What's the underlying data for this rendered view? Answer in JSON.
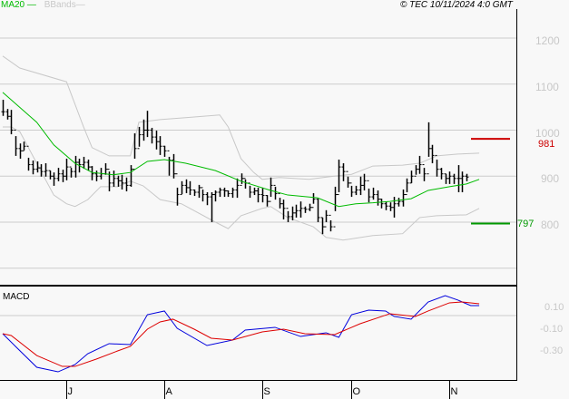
{
  "header": {
    "legend_ma": "MA20",
    "legend_bb": "BBands",
    "timestamp": "© TEC 10/11/2024 4:0 GMT"
  },
  "macd_label": "MACD",
  "chart_data": {
    "type": "ohlc",
    "price_axis": {
      "ticks": [
        1200,
        1100,
        1000,
        900,
        800,
        700
      ],
      "labels": [
        "1200",
        "1100",
        "1000",
        "900",
        "800"
      ],
      "ylim": [
        700,
        1200
      ]
    },
    "macd_axis": {
      "labels": [
        "0.10",
        "-0.10",
        "-0.30"
      ],
      "values": [
        0.1,
        -0.1,
        -0.3
      ],
      "grid": [
        0.1
      ]
    },
    "x_ticks": [
      {
        "label": "J",
        "bar": 15
      },
      {
        "label": "A",
        "bar": 38
      },
      {
        "label": "S",
        "bar": 61
      },
      {
        "label": "O",
        "bar": 82
      },
      {
        "label": "N",
        "bar": 105
      }
    ],
    "bars": [
      [
        1066,
        1031,
        1040
      ],
      [
        1046,
        1023,
        1030
      ],
      [
        1044,
        991,
        1000
      ],
      [
        987,
        944,
        960
      ],
      [
        971,
        938,
        955
      ],
      [
        975,
        956,
        965
      ],
      [
        940,
        912,
        925
      ],
      [
        934,
        904,
        915
      ],
      [
        932,
        908,
        918
      ],
      [
        926,
        899,
        910
      ],
      [
        928,
        899,
        912
      ],
      [
        912,
        893,
        900
      ],
      [
        908,
        879,
        895
      ],
      [
        918,
        889,
        905
      ],
      [
        914,
        887,
        900
      ],
      [
        938,
        891,
        920
      ],
      [
        918,
        897,
        910
      ],
      [
        944,
        897,
        930
      ],
      [
        938,
        908,
        925
      ],
      [
        942,
        916,
        930
      ],
      [
        936,
        912,
        920
      ],
      [
        922,
        891,
        905
      ],
      [
        912,
        889,
        900
      ],
      [
        918,
        893,
        905
      ],
      [
        928,
        903,
        915
      ],
      [
        910,
        867,
        885
      ],
      [
        912,
        877,
        895
      ],
      [
        901,
        877,
        890
      ],
      [
        903,
        871,
        885
      ],
      [
        897,
        867,
        880
      ],
      [
        924,
        877,
        915
      ],
      [
        993,
        938,
        960
      ],
      [
        1007,
        964,
        990
      ],
      [
        1023,
        977,
        1000
      ],
      [
        1042,
        985,
        1000
      ],
      [
        1005,
        971,
        985
      ],
      [
        999,
        958,
        975
      ],
      [
        987,
        946,
        965
      ],
      [
        966,
        942,
        955
      ],
      [
        942,
        901,
        935
      ],
      [
        948,
        895,
        905
      ],
      [
        875,
        836,
        860
      ],
      [
        889,
        861,
        880
      ],
      [
        893,
        863,
        875
      ],
      [
        889,
        859,
        870
      ],
      [
        871,
        857,
        865
      ],
      [
        881,
        853,
        875
      ],
      [
        871,
        845,
        860
      ],
      [
        865,
        837,
        855
      ],
      [
        865,
        800,
        860
      ],
      [
        869,
        845,
        865
      ],
      [
        875,
        855,
        870
      ],
      [
        875,
        855,
        868
      ],
      [
        869,
        855,
        862
      ],
      [
        875,
        853,
        870
      ],
      [
        895,
        853,
        880
      ],
      [
        906,
        883,
        895
      ],
      [
        893,
        873,
        885
      ],
      [
        879,
        853,
        865
      ],
      [
        875,
        859,
        868
      ],
      [
        875,
        843,
        860
      ],
      [
        875,
        843,
        858
      ],
      [
        859,
        834,
        845
      ],
      [
        897,
        855,
        880
      ],
      [
        877,
        849,
        862
      ],
      [
        853,
        830,
        840
      ],
      [
        849,
        806,
        830
      ],
      [
        824,
        800,
        812
      ],
      [
        834,
        804,
        820
      ],
      [
        838,
        810,
        825
      ],
      [
        845,
        810,
        830
      ],
      [
        834,
        820,
        828
      ],
      [
        840,
        824,
        832
      ],
      [
        863,
        840,
        850
      ],
      [
        851,
        800,
        810
      ],
      [
        810,
        774,
        790
      ],
      [
        826,
        800,
        815
      ],
      [
        804,
        780,
        790
      ],
      [
        877,
        824,
        860
      ],
      [
        936,
        865,
        920
      ],
      [
        928,
        889,
        910
      ],
      [
        899,
        875,
        885
      ],
      [
        879,
        855,
        865
      ],
      [
        879,
        859,
        870
      ],
      [
        899,
        859,
        880
      ],
      [
        905,
        869,
        890
      ],
      [
        873,
        843,
        855
      ],
      [
        875,
        849,
        860
      ],
      [
        869,
        836,
        850
      ],
      [
        851,
        830,
        840
      ],
      [
        845,
        826,
        835
      ],
      [
        843,
        824,
        832
      ],
      [
        855,
        810,
        840
      ],
      [
        853,
        834,
        845
      ],
      [
        871,
        834,
        860
      ],
      [
        895,
        865,
        885
      ],
      [
        912,
        885,
        900
      ],
      [
        924,
        903,
        915
      ],
      [
        944,
        905,
        925
      ],
      [
        918,
        889,
        905
      ],
      [
        1017,
        942,
        960
      ],
      [
        968,
        928,
        945
      ],
      [
        936,
        899,
        915
      ],
      [
        918,
        893,
        905
      ],
      [
        905,
        883,
        895
      ],
      [
        910,
        883,
        900
      ],
      [
        905,
        883,
        895
      ],
      [
        924,
        865,
        895
      ],
      [
        910,
        865,
        900
      ],
      [
        905,
        889,
        898
      ]
    ],
    "ma20": [
      [
        0,
        1082
      ],
      [
        8,
        1017
      ],
      [
        12,
        968
      ],
      [
        17,
        928
      ],
      [
        21,
        908
      ],
      [
        26,
        903
      ],
      [
        30,
        908
      ],
      [
        34,
        932
      ],
      [
        38,
        936
      ],
      [
        43,
        928
      ],
      [
        50,
        912
      ],
      [
        56,
        889
      ],
      [
        63,
        869
      ],
      [
        67,
        859
      ],
      [
        74,
        853
      ],
      [
        79,
        834
      ],
      [
        83,
        840
      ],
      [
        87,
        842
      ],
      [
        91,
        845
      ],
      [
        96,
        851
      ],
      [
        100,
        869
      ],
      [
        105,
        877
      ],
      [
        109,
        883
      ],
      [
        112,
        893
      ]
    ],
    "bb_upper": [
      [
        0,
        1161
      ],
      [
        4,
        1135
      ],
      [
        15,
        1105
      ],
      [
        19,
        1007
      ],
      [
        21,
        962
      ],
      [
        25,
        944
      ],
      [
        30,
        944
      ],
      [
        32,
        1017
      ],
      [
        37,
        1023
      ],
      [
        43,
        1027
      ],
      [
        51,
        1033
      ],
      [
        53,
        1007
      ],
      [
        56,
        938
      ],
      [
        59,
        908
      ],
      [
        61,
        893
      ],
      [
        65,
        897
      ],
      [
        72,
        893
      ],
      [
        77,
        899
      ],
      [
        82,
        904
      ],
      [
        87,
        922
      ],
      [
        94,
        924
      ],
      [
        98,
        928
      ],
      [
        102,
        944
      ],
      [
        107,
        948
      ],
      [
        112,
        950
      ]
    ],
    "bb_lower": [
      [
        0,
        1007
      ],
      [
        2,
        1007
      ],
      [
        4,
        997
      ],
      [
        8,
        928
      ],
      [
        12,
        859
      ],
      [
        15,
        840
      ],
      [
        17,
        834
      ],
      [
        20,
        849
      ],
      [
        23,
        877
      ],
      [
        27,
        877
      ],
      [
        30,
        889
      ],
      [
        33,
        879
      ],
      [
        37,
        849
      ],
      [
        42,
        840
      ],
      [
        50,
        800
      ],
      [
        53,
        786
      ],
      [
        56,
        814
      ],
      [
        61,
        830
      ],
      [
        63,
        834
      ],
      [
        67,
        810
      ],
      [
        73,
        790
      ],
      [
        76,
        767
      ],
      [
        80,
        761
      ],
      [
        87,
        771
      ],
      [
        94,
        775
      ],
      [
        98,
        810
      ],
      [
        102,
        814
      ],
      [
        109,
        816
      ],
      [
        112,
        830
      ]
    ],
    "macd": [
      [
        0,
        -0.067
      ],
      [
        3,
        -0.183
      ],
      [
        8,
        -0.375
      ],
      [
        13,
        -0.417
      ],
      [
        17,
        -0.35
      ],
      [
        20,
        -0.25
      ],
      [
        25,
        -0.158
      ],
      [
        30,
        -0.167
      ],
      [
        34,
        0.108
      ],
      [
        38,
        0.142
      ],
      [
        41,
        -0.017
      ],
      [
        48,
        -0.175
      ],
      [
        54,
        -0.125
      ],
      [
        57,
        -0.033
      ],
      [
        64,
        -0.008
      ],
      [
        70,
        -0.092
      ],
      [
        76,
        -0.058
      ],
      [
        79,
        -0.1
      ],
      [
        82,
        0.108
      ],
      [
        86,
        0.15
      ],
      [
        90,
        0.142
      ],
      [
        92,
        0.092
      ],
      [
        96,
        0.067
      ],
      [
        100,
        0.225
      ],
      [
        104,
        0.283
      ],
      [
        107,
        0.242
      ],
      [
        110,
        0.192
      ],
      [
        112,
        0.192
      ]
    ],
    "signal": [
      [
        0,
        -0.067
      ],
      [
        2,
        -0.083
      ],
      [
        8,
        -0.267
      ],
      [
        14,
        -0.367
      ],
      [
        17,
        -0.367
      ],
      [
        22,
        -0.3
      ],
      [
        27,
        -0.225
      ],
      [
        30,
        -0.183
      ],
      [
        34,
        -0.025
      ],
      [
        37,
        0.042
      ],
      [
        40,
        0.067
      ],
      [
        45,
        -0.025
      ],
      [
        49,
        -0.108
      ],
      [
        54,
        -0.125
      ],
      [
        61,
        -0.05
      ],
      [
        66,
        -0.025
      ],
      [
        71,
        -0.067
      ],
      [
        78,
        -0.075
      ],
      [
        84,
        0.025
      ],
      [
        91,
        0.117
      ],
      [
        97,
        0.092
      ],
      [
        100,
        0.142
      ],
      [
        105,
        0.217
      ],
      [
        108,
        0.225
      ],
      [
        112,
        0.208
      ]
    ],
    "levels": [
      {
        "label": "981",
        "value": 981,
        "color": "#cc0000"
      },
      {
        "label": "797",
        "value": 797,
        "color": "#009900"
      }
    ],
    "colors": {
      "bars": "#000000",
      "ma20": "#00bb00",
      "bbands": "#c8c8c8",
      "macd": "#0000dd",
      "signal": "#dd0000",
      "grid": "#cccccc"
    }
  }
}
